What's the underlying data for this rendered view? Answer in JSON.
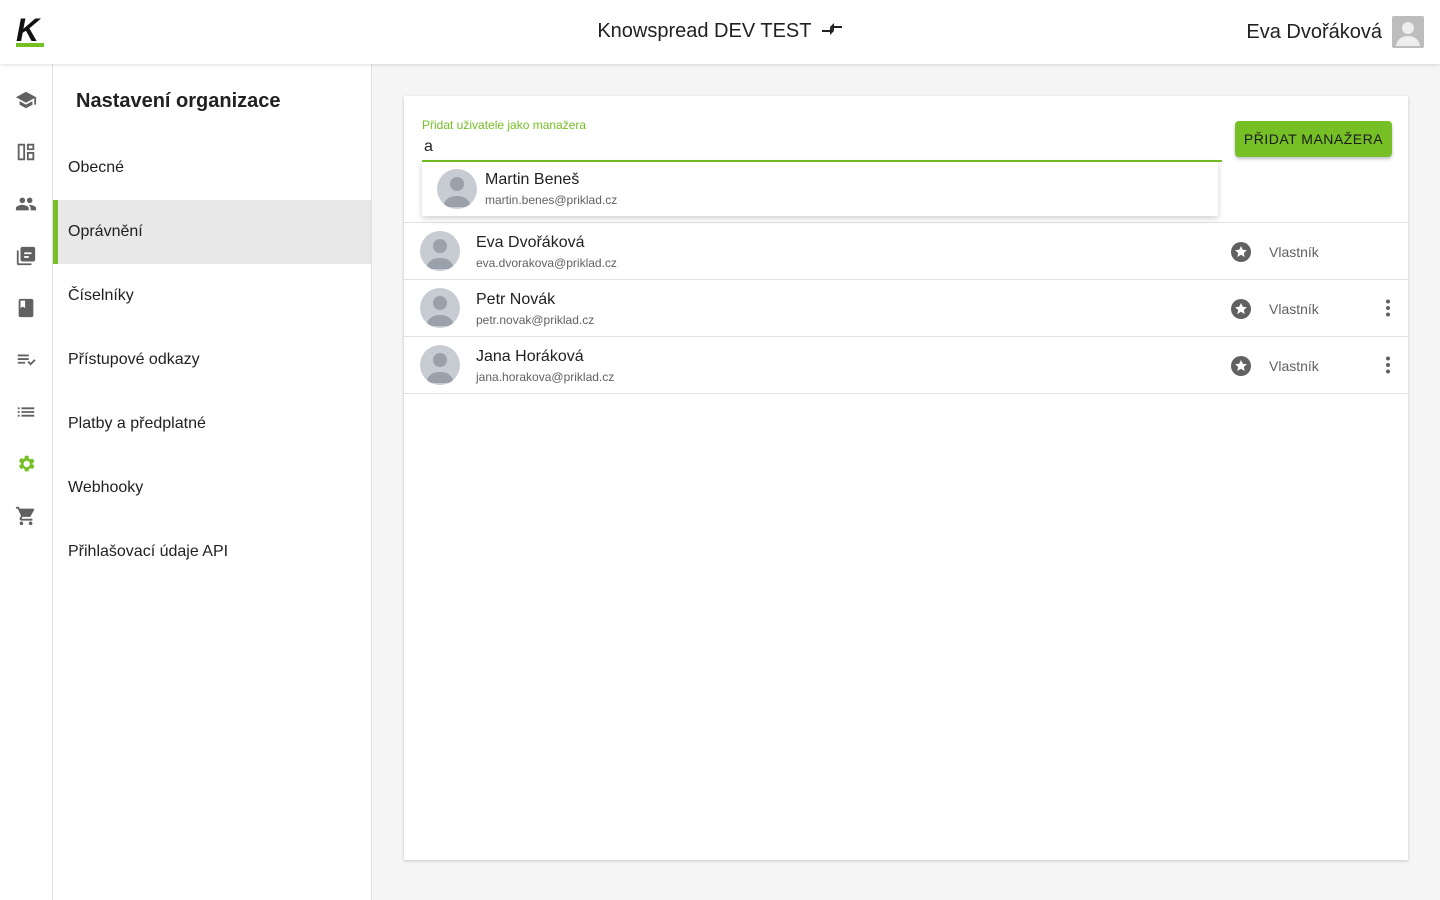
{
  "header": {
    "logo_letter": "K",
    "organization": "Knowspread DEV TEST",
    "user_name": "Eva Dvořáková"
  },
  "rail": {
    "items": [
      {
        "icon": "school-icon",
        "active": false
      },
      {
        "icon": "dashboard-icon",
        "active": false
      },
      {
        "icon": "people-icon",
        "active": false
      },
      {
        "icon": "library-icon",
        "active": false
      },
      {
        "icon": "book-icon",
        "active": false
      },
      {
        "icon": "playlist-check-icon",
        "active": false
      },
      {
        "icon": "list-icon",
        "active": false
      },
      {
        "icon": "settings-icon",
        "active": true
      },
      {
        "icon": "cart-icon",
        "active": false
      }
    ],
    "accent_color": "#76bf25"
  },
  "subnav": {
    "title": "Nastavení organizace",
    "items": [
      {
        "label": "Obecné"
      },
      {
        "label": "Oprávnění",
        "active": true
      },
      {
        "label": "Číselníky"
      },
      {
        "label": "Přístupové odkazy"
      },
      {
        "label": "Platby a předplatné"
      },
      {
        "label": "Webhooky"
      },
      {
        "label": "Přihlašovací údaje API"
      }
    ]
  },
  "add_manager": {
    "label": "Přidat uživatele jako manažera",
    "value": "a",
    "button_label": "PŘIDAT MANAŽERA",
    "suggestions": [
      {
        "name": "Martin Beneš",
        "email": "martin.benes@priklad.cz"
      }
    ]
  },
  "managers": [
    {
      "name": "Eva Dvořáková",
      "email": "eva.dvorakova@priklad.cz",
      "role": "Vlastník",
      "has_menu": false
    },
    {
      "name": "Petr Novák",
      "email": "petr.novak@priklad.cz",
      "role": "Vlastník",
      "has_menu": true
    },
    {
      "name": "Jana Horáková",
      "email": "jana.horakova@priklad.cz",
      "role": "Vlastník",
      "has_menu": true
    }
  ]
}
